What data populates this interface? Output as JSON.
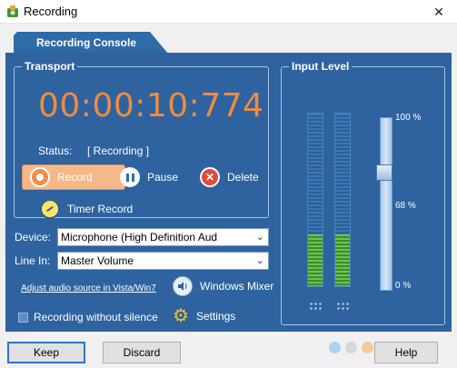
{
  "window": {
    "title": "Recording",
    "close_glyph": "✕"
  },
  "tab": {
    "label": "Recording Console"
  },
  "transport": {
    "title": "Transport",
    "timer": "00:00:10:774",
    "status_label": "Status:",
    "status_value": "[ Recording ]",
    "record_label": "Record",
    "pause_label": "Pause",
    "delete_label": "Delete",
    "timer_record_label": "Timer Record"
  },
  "device": {
    "label": "Device:",
    "value": "Microphone (High Definition Aud"
  },
  "line_in": {
    "label": "Line In:",
    "value": "Master Volume"
  },
  "adjust_link": "Adjust audio source in Vista/Win7",
  "windows_mixer_label": "Windows Mixer",
  "recording_without_silence_label": "Recording without silence",
  "recording_without_silence_checked": false,
  "settings_label": "Settings",
  "input_level": {
    "title": "Input Level",
    "scale_top": "100 %",
    "scale_mid": "68 %",
    "scale_bottom": "0 %",
    "left_level_percent": 30,
    "right_level_percent": 30,
    "slider_percent": 68
  },
  "buttons": {
    "keep": "Keep",
    "discard": "Discard",
    "help": "Help"
  },
  "colors": {
    "panel": "#2e63a0",
    "timer": "#f08b3c",
    "record_button": "#f6b889",
    "meter_fill": "#6bc34b"
  }
}
